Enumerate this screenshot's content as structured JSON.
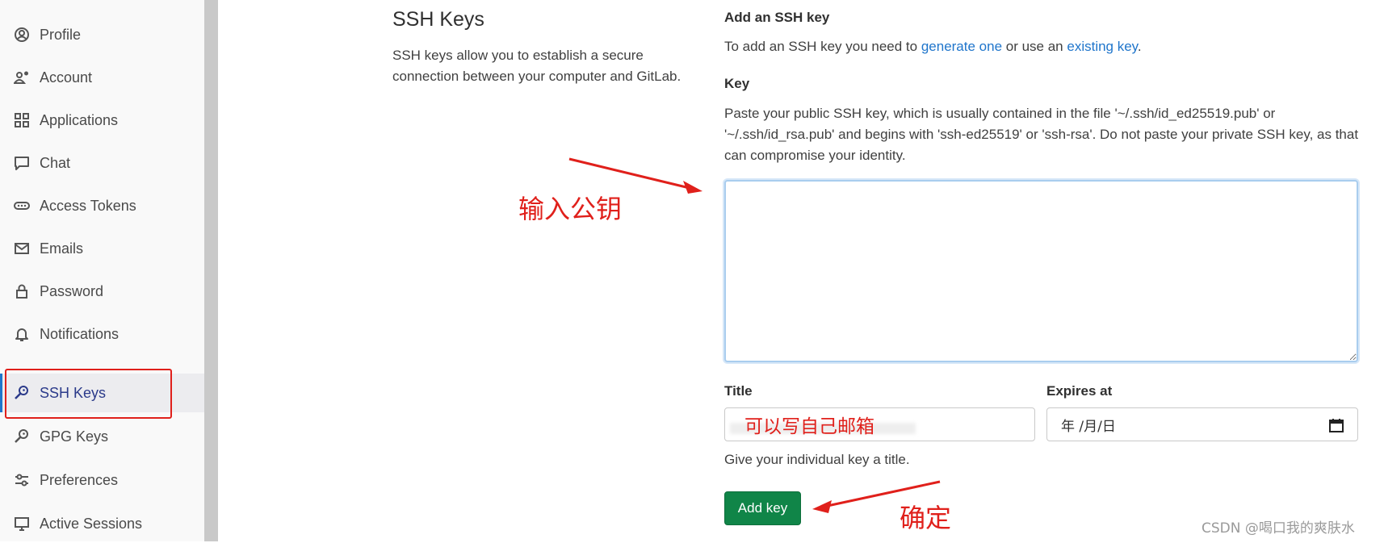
{
  "sidebar": {
    "items": [
      {
        "label": "Profile",
        "icon": "profile-icon"
      },
      {
        "label": "Account",
        "icon": "account-icon"
      },
      {
        "label": "Applications",
        "icon": "applications-icon"
      },
      {
        "label": "Chat",
        "icon": "chat-icon"
      },
      {
        "label": "Access Tokens",
        "icon": "access-tokens-icon"
      },
      {
        "label": "Emails",
        "icon": "mail-icon"
      },
      {
        "label": "Password",
        "icon": "lock-icon"
      },
      {
        "label": "Notifications",
        "icon": "bell-icon"
      },
      {
        "label": "SSH Keys",
        "icon": "key-icon",
        "active": true
      },
      {
        "label": "GPG Keys",
        "icon": "key-icon"
      },
      {
        "label": "Preferences",
        "icon": "preferences-icon"
      },
      {
        "label": "Active Sessions",
        "icon": "monitor-icon"
      }
    ]
  },
  "section": {
    "title": "SSH Keys",
    "description": "SSH keys allow you to establish a secure connection between your computer and GitLab."
  },
  "form": {
    "heading": "Add an SSH key",
    "intro_prefix": "To add an SSH key you need to ",
    "generate_link": "generate one",
    "intro_middle": " or use an ",
    "existing_link": "existing key",
    "intro_suffix": ".",
    "key_label": "Key",
    "key_help": "Paste your public SSH key, which is usually contained in the file '~/.ssh/id_ed25519.pub' or '~/.ssh/id_rsa.pub' and begins with 'ssh-ed25519' or 'ssh-rsa'. Do not paste your private SSH key, as that can compromise your identity.",
    "key_value": "",
    "title_label": "Title",
    "title_annotation": "可以写自己邮箱",
    "expires_label": "Expires at",
    "expires_placeholder": "年 /月/日",
    "title_help": "Give your individual key a title.",
    "add_button": "Add key"
  },
  "annotations": {
    "key_note": "输入公钥",
    "confirm_note": "确定",
    "color": "#e0201b"
  },
  "watermark": "CSDN @喝口我的爽肤水",
  "colors": {
    "link": "#1f75cb",
    "primary_button": "#108548",
    "active_nav": "#2b3a8a"
  }
}
